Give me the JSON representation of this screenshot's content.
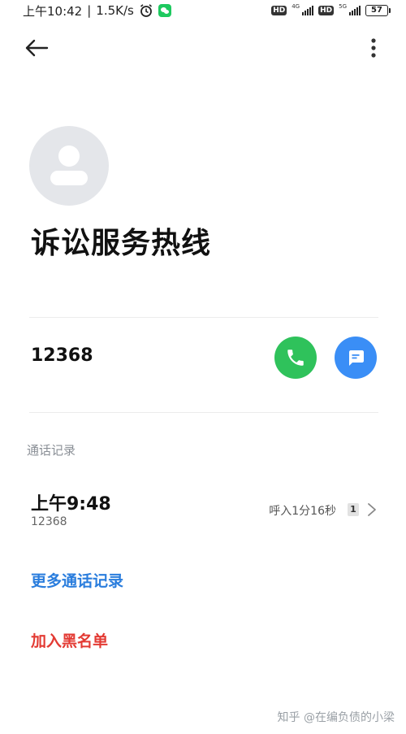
{
  "status_bar": {
    "time": "上午10:42",
    "separator": "|",
    "speed": "1.5K/s",
    "hd1": "HD",
    "net1": "4G",
    "hd2": "HD",
    "net2": "5G",
    "battery": "57"
  },
  "contact": {
    "name": "诉讼服务热线",
    "number": "12368"
  },
  "call_log": {
    "title": "通话记录",
    "entries": [
      {
        "time": "上午9:48",
        "number": "12368",
        "duration": "呼入1分16秒",
        "count": "1"
      }
    ]
  },
  "actions": {
    "more_logs": "更多通话记录",
    "block": "加入黑名单"
  },
  "watermark": "知乎 @在编负债的小梁",
  "colors": {
    "call_green": "#2fc25b",
    "message_blue": "#3a8ef6",
    "link_blue": "#2a7ddd",
    "danger_red": "#e33a33"
  },
  "icons": {
    "back": "arrow-left-icon",
    "more": "more-vertical-icon",
    "avatar": "person-icon",
    "call": "phone-icon",
    "message": "message-icon",
    "chevron": "chevron-right-icon"
  }
}
